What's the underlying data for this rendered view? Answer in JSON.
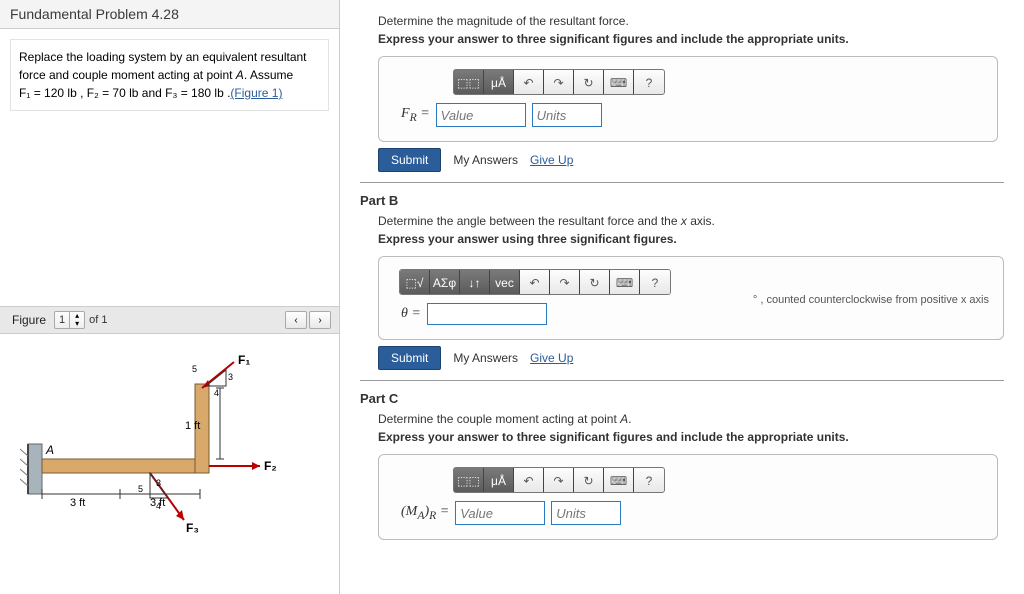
{
  "title": "Fundamental Problem 4.28",
  "problem_box": {
    "line1": "Replace the loading system by an equivalent resultant force and couple moment acting at point ",
    "point": "A",
    "line2": ". Assume ",
    "f1": "F₁ = 120 lb",
    "f2": "F₂ = 70 lb",
    "f3": "F₃ = 180 lb",
    "figure_link": "(Figure 1)"
  },
  "figure_header": {
    "label": "Figure",
    "current": "1",
    "of_label": "of 1"
  },
  "diagram": {
    "point_A": "A",
    "dim_3ft_a": "3 ft",
    "dim_3ft_b": "3 ft",
    "dim_1ft": "1 ft",
    "F1": "F₁",
    "F2": "F₂",
    "F3": "F₃",
    "s5a": "5",
    "s4a": "4",
    "s3a": "3",
    "s5b": "5",
    "s4b": "4",
    "s3b": "3"
  },
  "partA": {
    "prompt": "Determine the magnitude of the resultant force.",
    "bold": "Express your answer to three significant figures and include the appropriate units.",
    "eq_label": "F_R =",
    "value_ph": "Value",
    "units_ph": "Units",
    "toolbar": {
      "t1": "⬚⬚",
      "t2": "μÅ",
      "undo": "↶",
      "redo": "↷",
      "reset": "↻",
      "kb": "⌨",
      "help": "?"
    }
  },
  "partB": {
    "title": "Part B",
    "prompt": "Determine the angle between the resultant force and the x axis.",
    "bold": "Express your answer using three significant figures.",
    "eq_label": "θ =",
    "hint": ", counted counterclockwise from positive x axis",
    "degree": "°",
    "toolbar": {
      "t1": "⬚√",
      "t2": "ΑΣφ",
      "t3": "↓↑",
      "t4": "vec",
      "undo": "↶",
      "redo": "↷",
      "reset": "↻",
      "kb": "⌨",
      "help": "?"
    }
  },
  "partC": {
    "title": "Part C",
    "prompt": "Determine the couple moment acting at point A.",
    "bold": "Express your answer to three significant figures and include the appropriate units.",
    "eq_label": "(M_A)_R =",
    "value_ph": "Value",
    "units_ph": "Units",
    "toolbar": {
      "t1": "⬚⬚",
      "t2": "μÅ",
      "undo": "↶",
      "redo": "↷",
      "reset": "↻",
      "kb": "⌨",
      "help": "?"
    }
  },
  "common": {
    "submit": "Submit",
    "my_answers": "My Answers",
    "give_up": "Give Up"
  }
}
